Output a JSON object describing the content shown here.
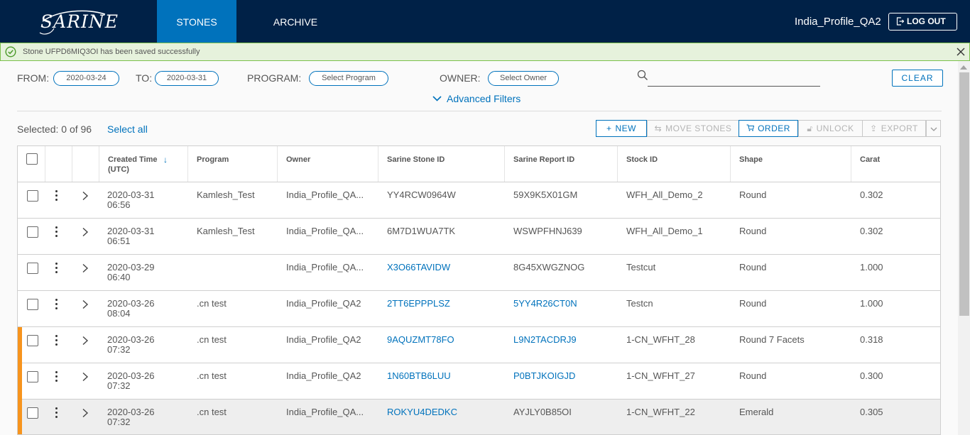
{
  "brand": {
    "logo_text": "SARINE"
  },
  "nav": {
    "tabs": [
      {
        "label": "STONES",
        "active": true
      },
      {
        "label": "ARCHIVE",
        "active": false
      }
    ],
    "user": "India_Profile_QA2",
    "logout_label": "LOG OUT"
  },
  "alert": {
    "message": "Stone UFPD6MIQ3OI has been saved successfully",
    "type": "success"
  },
  "filters": {
    "from_label": "FROM:",
    "from_value": "2020-03-24",
    "to_label": "TO:",
    "to_value": "2020-03-31",
    "program_label": "PROGRAM:",
    "program_value": "Select Program",
    "owner_label": "OWNER:",
    "owner_value": "Select Owner",
    "search_value": "",
    "clear_label": "CLEAR",
    "advanced_label": "Advanced Filters"
  },
  "selection": {
    "text": "Selected: 0 of 96",
    "select_all": "Select all"
  },
  "toolbar": {
    "new_label": "NEW",
    "move_label": "MOVE STONES",
    "order_label": "ORDER",
    "unlock_label": "UNLOCK",
    "export_label": "EXPORT"
  },
  "table": {
    "columns": [
      "Created Time (UTC)",
      "Program",
      "Owner",
      "Sarine Stone ID",
      "Sarine Report ID",
      "Stock ID",
      "Shape",
      "Carat"
    ],
    "col_created_1": "Created Time",
    "col_created_2": "(UTC)",
    "rows": [
      {
        "date": "2020-03-31",
        "time": "06:56",
        "program": "Kamlesh_Test",
        "owner": "India_Profile_QA...",
        "stone_id": "YY4RCW0964W",
        "report_id": "59X9K5X01GM",
        "stock_id": "WFH_All_Demo_2",
        "shape": "Round",
        "carat": "0.302",
        "flag": false,
        "highlight": false
      },
      {
        "date": "2020-03-31",
        "time": "06:51",
        "program": "Kamlesh_Test",
        "owner": "India_Profile_QA...",
        "stone_id": "6M7D1WUA7TK",
        "report_id": "WSWPFHNJ639",
        "stock_id": "WFH_All_Demo_1",
        "shape": "Round",
        "carat": "0.302",
        "flag": false,
        "highlight": false
      },
      {
        "date": "2020-03-29",
        "time": "06:40",
        "program": "",
        "owner": "India_Profile_QA...",
        "stone_id": "X3O66TAVIDW",
        "report_id": "8G45XWGZNOG",
        "stock_id": "Testcut",
        "shape": "Round",
        "carat": "1.000",
        "flag": false,
        "highlight": false
      },
      {
        "date": "2020-03-26",
        "time": "08:04",
        "program": ".cn test",
        "owner": "India_Profile_QA2",
        "stone_id": "2TT6EPPPLSZ",
        "report_id": "5YY4R26CT0N",
        "stock_id": "Testcn",
        "shape": "Round",
        "carat": "1.000",
        "flag": false,
        "highlight": false
      },
      {
        "date": "2020-03-26",
        "time": "07:32",
        "program": ".cn test",
        "owner": "India_Profile_QA2",
        "stone_id": "9AQUZMT78FO",
        "report_id": "L9N2TACDRJ9",
        "stock_id": "1-CN_WFHT_28",
        "shape": "Round 7 Facets",
        "carat": "0.318",
        "flag": true,
        "highlight": false
      },
      {
        "date": "2020-03-26",
        "time": "07:32",
        "program": ".cn test",
        "owner": "India_Profile_QA2",
        "stone_id": "1N60BTB6LUU",
        "report_id": "P0BTJKOIGJD",
        "stock_id": "1-CN_WFHT_27",
        "shape": "Round",
        "carat": "0.300",
        "flag": true,
        "highlight": false
      },
      {
        "date": "2020-03-26",
        "time": "07:32",
        "program": ".cn test",
        "owner": "India_Profile_QA...",
        "stone_id": "ROKYU4DEDKC",
        "report_id": "AYJLY0B85OI",
        "stock_id": "1-CN_WFHT_22",
        "shape": "Emerald",
        "carat": "0.305",
        "flag": true,
        "highlight": true
      }
    ]
  },
  "colors": {
    "nav_bg": "#002147",
    "accent": "#0072bc",
    "alert_bg": "#e6f2dc",
    "alert_border": "#7cc04b",
    "flag": "#f7941d"
  }
}
